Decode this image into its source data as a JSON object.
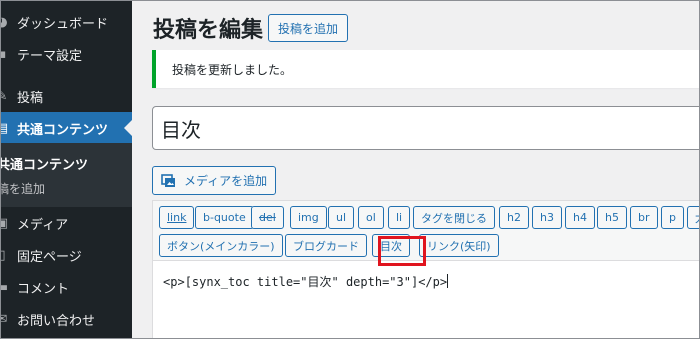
{
  "sidebar": {
    "items": [
      {
        "label": "ダッシュボード",
        "icon": "dashboard-icon"
      },
      {
        "label": "テーマ設定",
        "icon": "palette-icon"
      },
      {
        "label": "投稿",
        "icon": "pin-icon"
      },
      {
        "label": "共通コンテンツ",
        "icon": "document-icon",
        "active": true
      },
      {
        "label": "メディア",
        "icon": "media-icon"
      },
      {
        "label": "固定ページ",
        "icon": "page-icon"
      },
      {
        "label": "コメント",
        "icon": "comment-icon"
      },
      {
        "label": "お問い合わせ",
        "icon": "mail-icon"
      }
    ],
    "submenu": [
      "共通コンテンツ",
      "稿を追加"
    ]
  },
  "header": {
    "title": "投稿を編集",
    "add_new": "投稿を追加"
  },
  "notice": {
    "text": "投稿を更新しました。"
  },
  "post": {
    "title": "目次"
  },
  "media": {
    "label": "メディアを追加"
  },
  "editor": {
    "row1": [
      "link",
      "b-quote",
      "del",
      "img",
      "ul",
      "ol",
      "li",
      "タグを閉じる",
      "h2",
      "h3",
      "h4",
      "h5",
      "br",
      "p",
      "太"
    ],
    "row2": [
      "ボタン(メインカラー)",
      "ブログカード",
      "目次",
      "リンク(矢印)"
    ],
    "content_a": "<p>",
    "content_b": "[synx_toc title=\"目次\" depth=\"3\"]",
    "content_c": "</p>"
  },
  "colors": {
    "sidebar_bg": "#1d2327",
    "accent": "#2271b1",
    "notice_success": "#00a32a",
    "highlight": "#e0141e"
  }
}
